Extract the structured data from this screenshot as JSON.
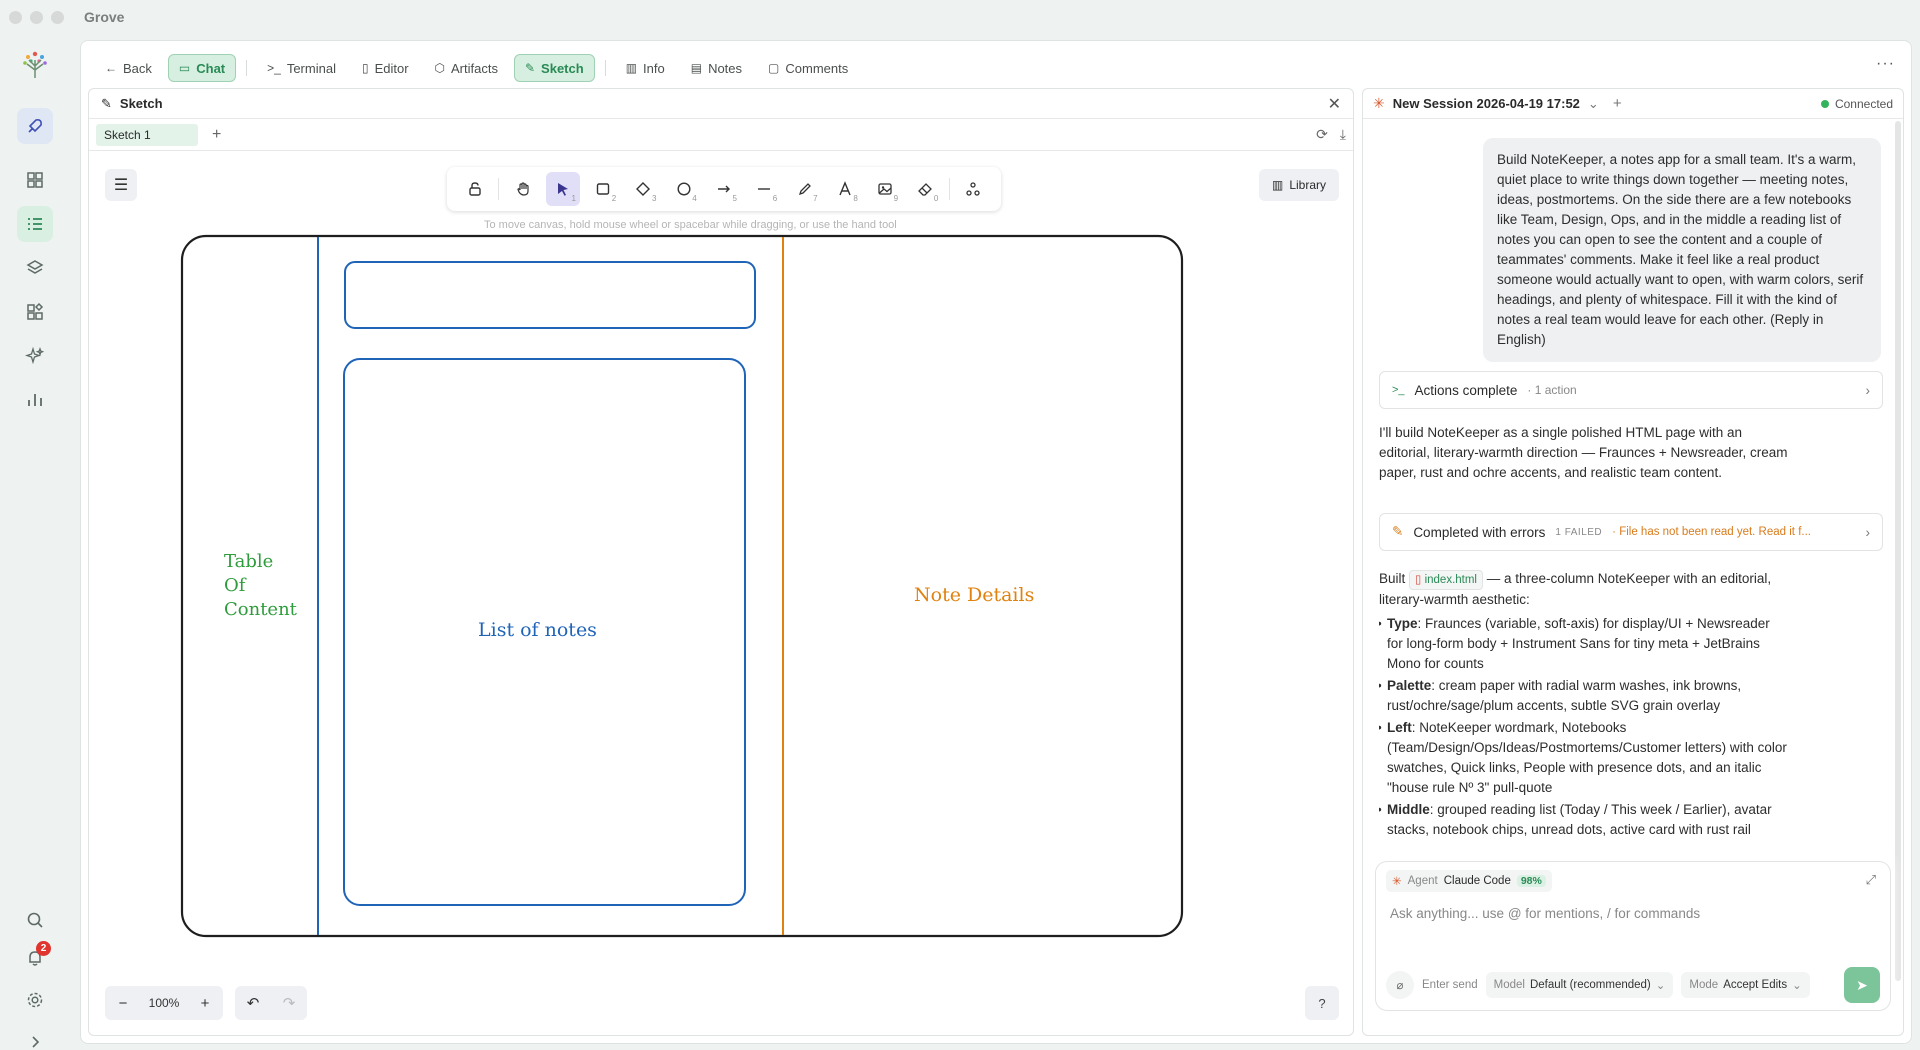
{
  "app": {
    "title": "Grove"
  },
  "rail": {
    "notifications_count": "2"
  },
  "tabs": {
    "back": "Back",
    "chat": "Chat",
    "terminal": "Terminal",
    "editor": "Editor",
    "artifacts": "Artifacts",
    "sketch": "Sketch",
    "info": "Info",
    "notes": "Notes",
    "comments": "Comments"
  },
  "sketch": {
    "title": "Sketch",
    "tab_name": "Sketch 1",
    "hint": "To move canvas, hold mouse wheel or spacebar while dragging, or use the hand tool",
    "library": "Library",
    "zoom": "100%",
    "labels": {
      "toc": [
        "Table",
        "Of",
        "Content"
      ],
      "list": "List of notes",
      "details": "Note Details"
    },
    "tool_keys": [
      "1",
      "2",
      "3",
      "4",
      "5",
      "6",
      "7",
      "8",
      "9",
      "0"
    ]
  },
  "chat": {
    "session": "New Session 2026-04-19 17:52",
    "status": "Connected",
    "user_message": "Build NoteKeeper, a notes app for a small team. It's a warm, quiet place to write things down together — meeting notes, ideas, postmortems. On the side there are a few notebooks like Team, Design, Ops, and in the middle a reading list of notes you can open to see the content and a couple of teammates' comments. Make it feel like a real product someone would actually want to open, with warm colors, serif headings, and plenty of whitespace. Fill it with the kind of notes a real team would leave for each other. (Reply in English)",
    "action1": {
      "title": "Actions complete",
      "sub": "· 1 action"
    },
    "assistant_intro": "I'll build NoteKeeper as a single polished HTML page with an editorial, literary-warmth direction — Fraunces + Newsreader, cream paper, rust and ochre accents, and realistic team content.",
    "action2": {
      "title": "Completed with errors",
      "count": "1 FAILED",
      "error": "· File has not been read yet. Read it f..."
    },
    "built_prefix": "Built",
    "file": "index.html",
    "built_suffix": "— a three-column NoteKeeper with an editorial, literary-warmth aesthetic:",
    "bullets": [
      {
        "k": "Type",
        "v": ": Fraunces (variable, soft-axis) for display/UI + Newsreader for long-form body + Instrument Sans for tiny meta + JetBrains Mono for counts"
      },
      {
        "k": "Palette",
        "v": ": cream paper with radial warm washes, ink browns, rust/ochre/sage/plum accents, subtle SVG grain overlay"
      },
      {
        "k": "Left",
        "v": ": NoteKeeper wordmark, Notebooks (Team/Design/Ops/Ideas/Postmortems/Customer letters) with color swatches, Quick links, People with presence dots, and an italic \"house rule Nº 3\" pull-quote"
      },
      {
        "k": "Middle",
        "v": ": grouped reading list (Today / This week / Earlier), avatar stacks, notebook chips, unread dots, active card with rust rail"
      }
    ],
    "composer": {
      "agent_label": "Agent",
      "agent_name": "Claude Code",
      "agent_pct": "98%",
      "placeholder": "Ask anything... use @ for mentions, / for commands",
      "enter_send": "Enter send",
      "model_label": "Model",
      "model_value": "Default (recommended)",
      "mode_label": "Mode",
      "mode_value": "Accept Edits"
    }
  }
}
